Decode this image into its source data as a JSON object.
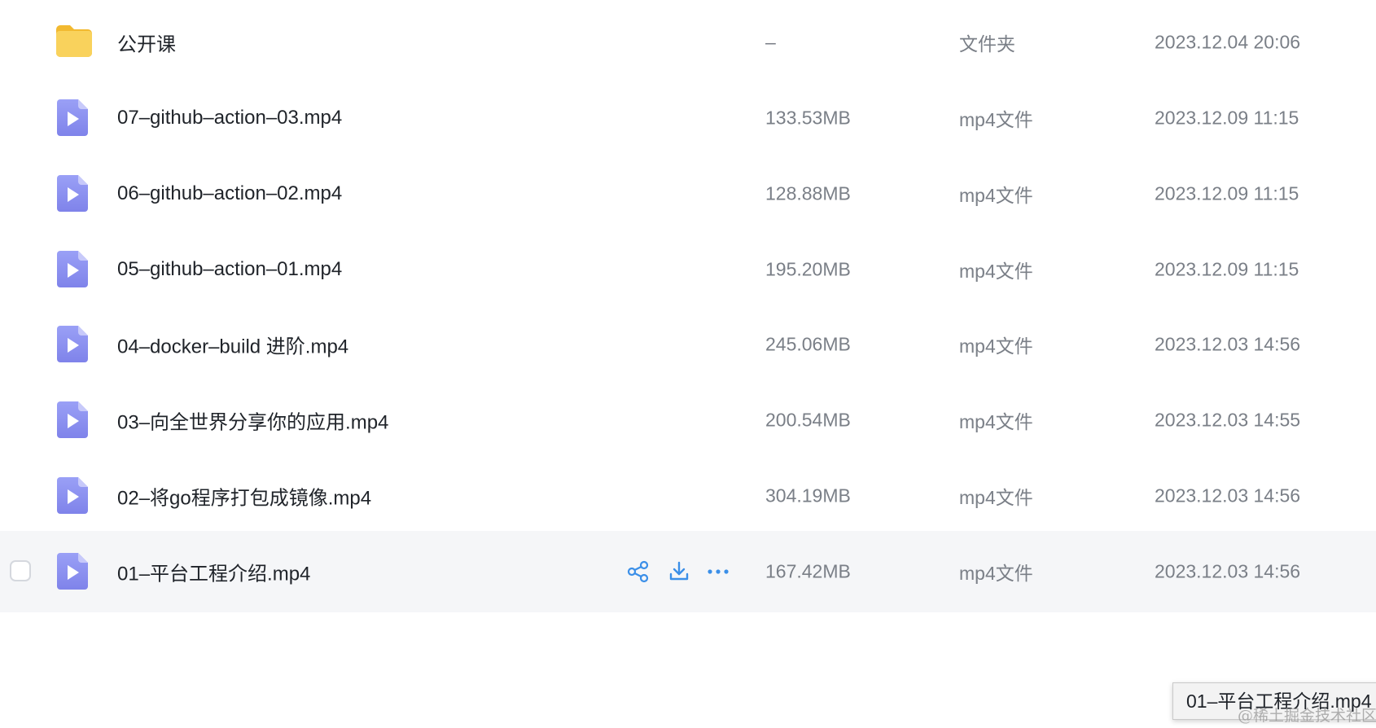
{
  "rows": [
    {
      "name": "公开课",
      "size": "–",
      "type": "文件夹",
      "date": "2023.12.04 20:06",
      "icon": "folder-icon",
      "hovered": false
    },
    {
      "name": "07–github–action–03.mp4",
      "size": "133.53MB",
      "type": "mp4文件",
      "date": "2023.12.09 11:15",
      "icon": "video-file-icon",
      "hovered": false
    },
    {
      "name": "06–github–action–02.mp4",
      "size": "128.88MB",
      "type": "mp4文件",
      "date": "2023.12.09 11:15",
      "icon": "video-file-icon",
      "hovered": false
    },
    {
      "name": "05–github–action–01.mp4",
      "size": "195.20MB",
      "type": "mp4文件",
      "date": "2023.12.09 11:15",
      "icon": "video-file-icon",
      "hovered": false
    },
    {
      "name": "04–docker–build 进阶.mp4",
      "size": "245.06MB",
      "type": "mp4文件",
      "date": "2023.12.03 14:56",
      "icon": "video-file-icon",
      "hovered": false
    },
    {
      "name": "03–向全世界分享你的应用.mp4",
      "size": "200.54MB",
      "type": "mp4文件",
      "date": "2023.12.03 14:55",
      "icon": "video-file-icon",
      "hovered": false
    },
    {
      "name": "02–将go程序打包成镜像.mp4",
      "size": "304.19MB",
      "type": "mp4文件",
      "date": "2023.12.03 14:56",
      "icon": "video-file-icon",
      "hovered": false
    },
    {
      "name": "01–平台工程介绍.mp4",
      "size": "167.42MB",
      "type": "mp4文件",
      "date": "2023.12.03 14:56",
      "icon": "video-file-icon",
      "hovered": true
    }
  ],
  "row_actions": {
    "share_icon": "share-icon",
    "download_icon": "download-icon",
    "more_icon": "more-icon"
  },
  "tooltip": {
    "text": "01–平台工程介绍.mp4"
  },
  "watermark": {
    "text": "@稀土掘金技术社区"
  },
  "colors": {
    "folder": "#f7c948",
    "video_icon": "#8b8ff0",
    "action_icon": "#3b8fe8",
    "hover_row": "#f5f6f8",
    "secondary_text": "#7a7f87"
  }
}
